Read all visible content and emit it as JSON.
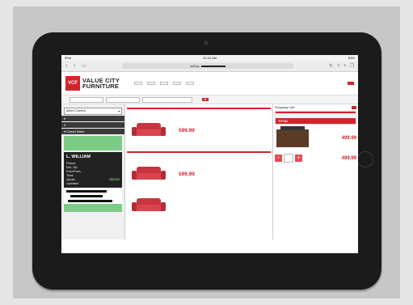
{
  "browser": {
    "carrier": "iPad",
    "clock": "10:42 AM",
    "battery": "83%",
    "url": "selling"
  },
  "header": {
    "logo_mark": "VCF",
    "brand_line1": "VALUE CITY",
    "brand_line2": "FURNITURE",
    "nav": [
      "",
      "",
      "",
      "",
      ""
    ],
    "store_label": "",
    "action": ""
  },
  "toolbar": {
    "labels": [
      "",
      ""
    ],
    "go": ""
  },
  "sidebar": {
    "label": "",
    "selected": "Albert Carrera",
    "section_bars": [
      "",
      "",
      "Closed Sales"
    ],
    "card_amount": "",
    "customer": {
      "name": "L. WILLIAM",
      "rows": [
        {
          "k": "Phone",
          "v": ""
        },
        {
          "k": "Del. Zip",
          "v": ""
        },
        {
          "k": "ExecFees",
          "v": ""
        },
        {
          "k": "Total",
          "v": ""
        },
        {
          "k": "Quote",
          "v": "285030"
        },
        {
          "k": "Updated",
          "v": ""
        }
      ]
    }
  },
  "main": {
    "sections": [
      {
        "header": "",
        "price": "599.99"
      },
      {
        "header": "",
        "price": "599.99"
      }
    ]
  },
  "cart": {
    "title": "Shopping Cart",
    "button": "",
    "totals_header": "",
    "lines": [
      {
        "k": "",
        "v": ""
      },
      {
        "k": "",
        "v": ""
      },
      {
        "k": "",
        "v": ""
      },
      {
        "k": "",
        "v": ""
      },
      {
        "k": "",
        "v": ""
      },
      {
        "k": "",
        "v": ""
      }
    ],
    "total_label": "TOTAL",
    "total_value": "",
    "items": [
      {
        "name": "",
        "price": "499.99"
      },
      {
        "name": "",
        "price": "499.99"
      }
    ],
    "qty_minus": "−",
    "qty_plus": "+"
  },
  "colors": {
    "brand_red": "#d2242b",
    "sidebar_green": "#7ccb86",
    "tablet_bezel": "#1b1b1b"
  },
  "icons": [
    "back-arrow-icon",
    "forward-arrow-icon",
    "book-icon",
    "reload-icon",
    "share-icon",
    "add-icon",
    "tabs-icon"
  ]
}
